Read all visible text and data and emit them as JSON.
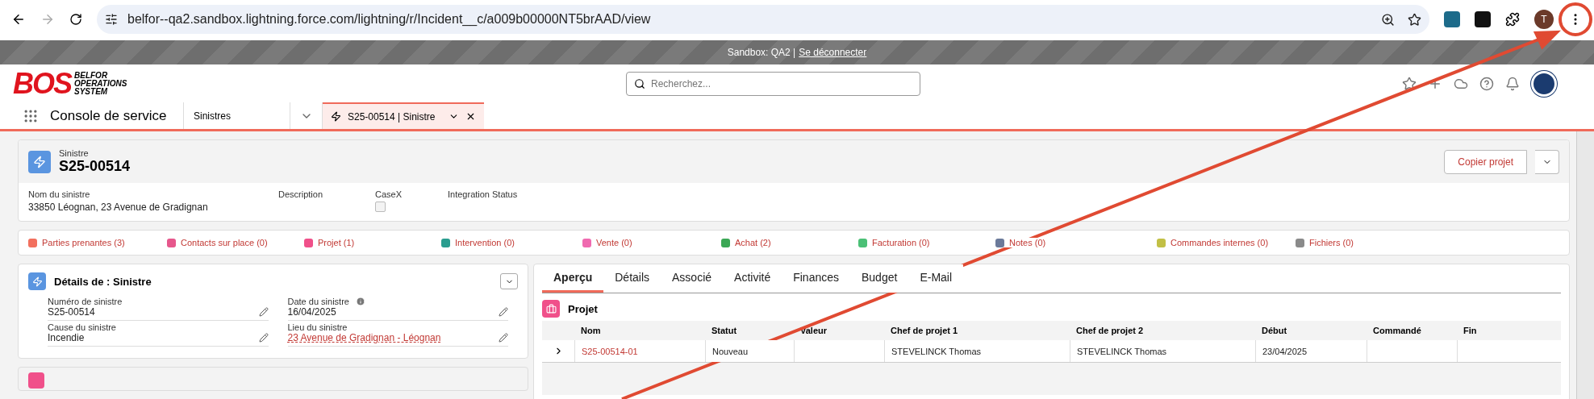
{
  "browser": {
    "url": "belfor--qa2.sandbox.lightning.force.com/lightning/r/Incident__c/a009b00000NT5brAAD/view",
    "profile_initial": "T"
  },
  "sandbox_banner": {
    "text": "Sandbox: QA2 |",
    "link": "Se déconnecter"
  },
  "header": {
    "logo_mark": "BOS",
    "logo_words": [
      "BELFOR",
      "OPERATIONS",
      "SYSTEM"
    ],
    "search": {
      "placeholder": "Recherchez..."
    }
  },
  "nav": {
    "app_name": "Console de service",
    "object_menu": "Sinistres",
    "tabs": [
      {
        "label": "S25-00514 | Sinistre",
        "selected": true
      }
    ]
  },
  "record": {
    "object": "Sinistre",
    "name": "S25-00514",
    "action": "Copier projet",
    "fields": [
      {
        "kind": "text",
        "label": "Nom du sinistre",
        "value": "33850 Léognan, 23 Avenue de Gradignan"
      },
      {
        "kind": "text",
        "label": "Description"
      },
      {
        "kind": "checkbox",
        "label": "CaseX",
        "checked": false
      },
      {
        "kind": "text",
        "label": "Integration Status"
      }
    ]
  },
  "related_links": [
    {
      "label": "Parties prenantes (3)",
      "color": "#f2705e"
    },
    {
      "label": "Contacts sur place (0)",
      "color": "#e6578c"
    },
    {
      "label": "Projet (1)",
      "color": "#f0508a"
    },
    {
      "label": "Intervention (0)",
      "color": "#2a9d8f"
    },
    {
      "label": "Vente (0)",
      "color": "#f06ab0"
    },
    {
      "label": "Achat (2)",
      "color": "#3ba755"
    },
    {
      "label": "Facturation (0)",
      "color": "#4bc076"
    },
    {
      "label": "Notes (0)",
      "color": "#6b7a9a"
    },
    {
      "label": "Commandes internes (0)",
      "color": "#c2c046"
    },
    {
      "label": "Fichiers (0)",
      "color": "#8a8a8a"
    }
  ],
  "details": {
    "title": "Détails de : Sinistre",
    "fields": [
      {
        "label": "Numéro de sinistre",
        "value": "S25-00514",
        "link": false,
        "info": false
      },
      {
        "label": "Date du sinistre",
        "value": "16/04/2025",
        "link": false,
        "info": true
      },
      {
        "label": "Cause du sinistre",
        "value": "Incendie",
        "link": false,
        "info": false
      },
      {
        "label": "Lieu du sinistre",
        "value": "23 Avenue de Gradignan - Léognan",
        "link": true,
        "info": false
      }
    ]
  },
  "tabs": [
    {
      "label": "Aperçu",
      "selected": true
    },
    {
      "label": "Détails",
      "selected": false
    },
    {
      "label": "Associé",
      "selected": false
    },
    {
      "label": "Activité",
      "selected": false
    },
    {
      "label": "Finances",
      "selected": false
    },
    {
      "label": "Budget",
      "selected": false
    },
    {
      "label": "E-Mail",
      "selected": false
    }
  ],
  "project_list": {
    "title": "Projet",
    "columns": [
      "Nom",
      "Statut",
      "Valeur",
      "Chef de projet 1",
      "Chef de projet 2",
      "Début",
      "Commandé",
      "Fin"
    ],
    "rows": [
      {
        "cells": [
          "S25-00514-01",
          "Nouveau",
          null,
          "STEVELINCK Thomas",
          "STEVELINCK Thomas",
          "23/04/2025",
          null,
          null
        ]
      }
    ]
  }
}
